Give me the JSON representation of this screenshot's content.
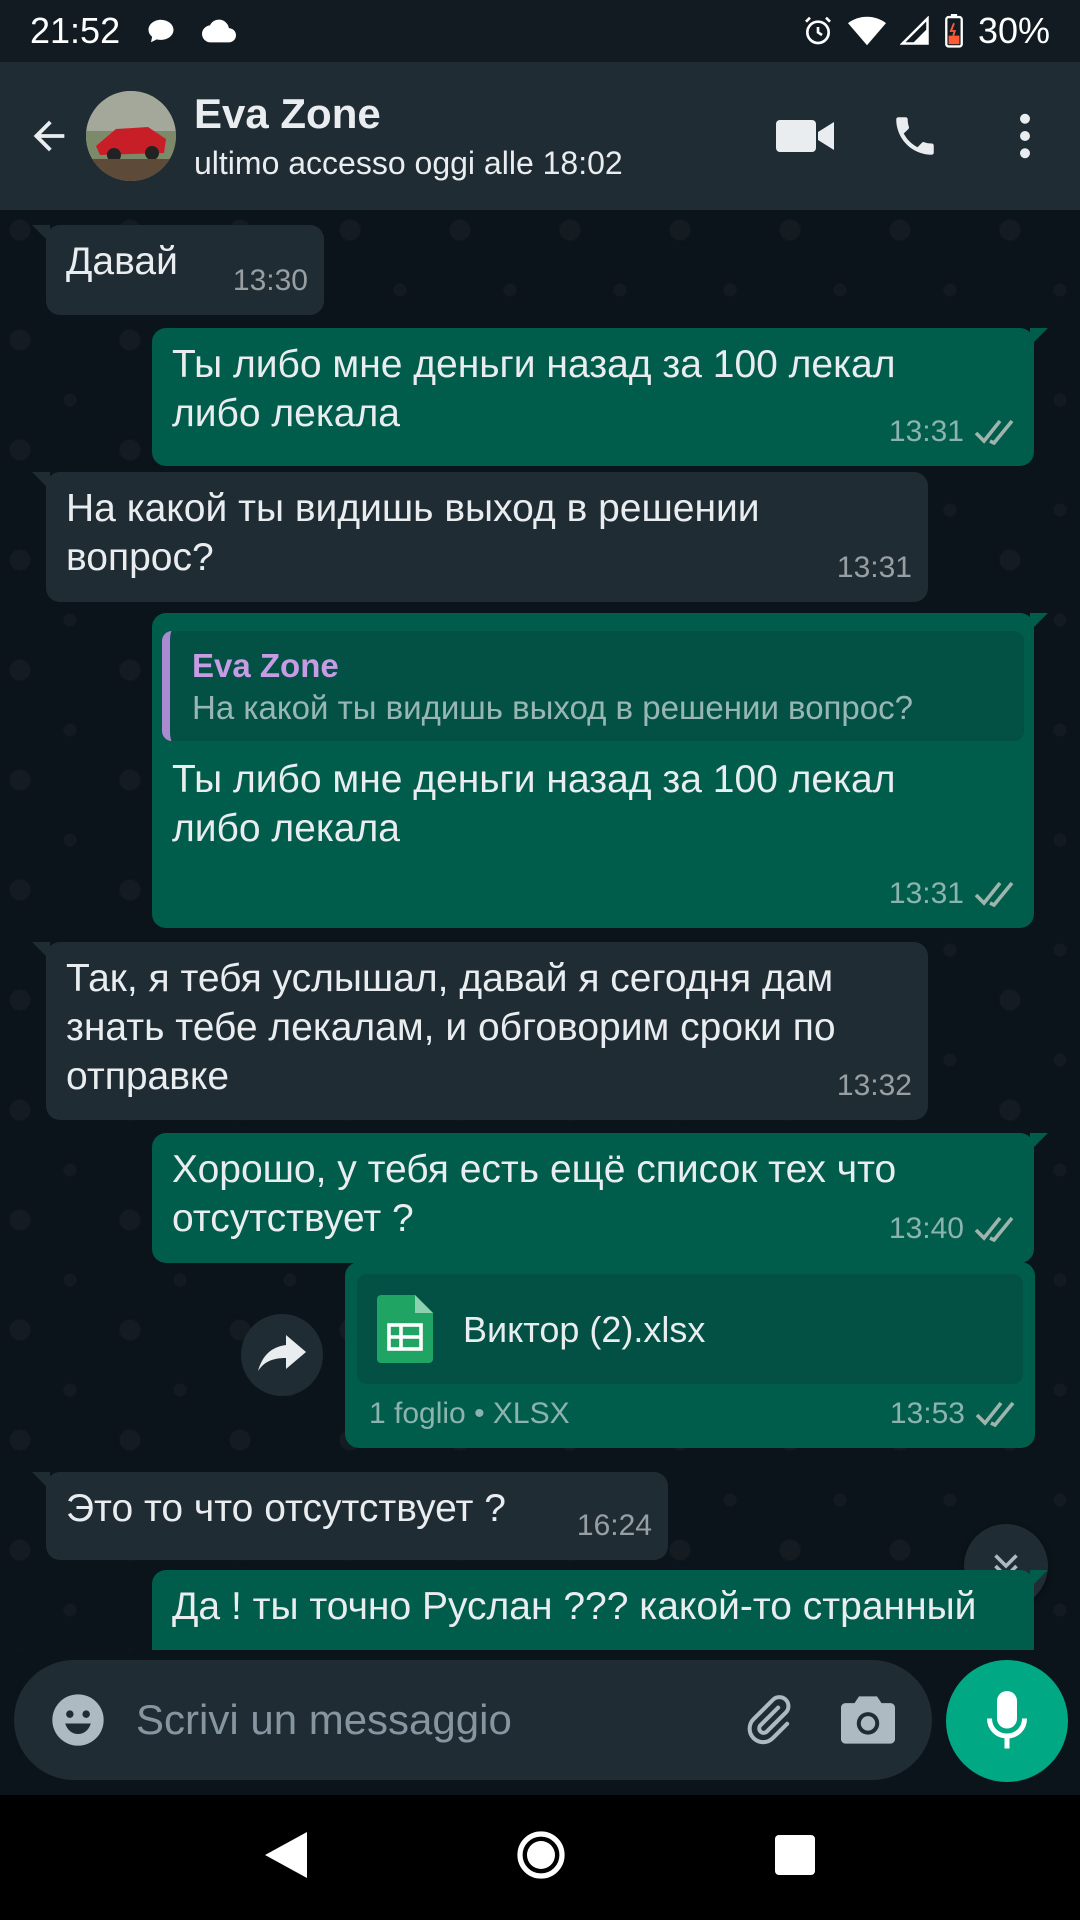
{
  "status_bar": {
    "time": "21:52",
    "battery": "30%",
    "icons": [
      "chat-bubble-icon",
      "cloud-icon",
      "alarm-icon",
      "wifi-icon",
      "signal-icon",
      "battery-icon"
    ]
  },
  "header": {
    "contact_name": "Eva Zone",
    "last_seen": "ultimo accesso oggi alle 18:02"
  },
  "messages": [
    {
      "dir": "in",
      "text": "Давай",
      "time": "13:30"
    },
    {
      "dir": "out",
      "text": "Ты либо мне деньги назад за 100 лекал либо лекала",
      "time": "13:31"
    },
    {
      "dir": "in",
      "text": "На какой ты видишь выход в решении вопрос?",
      "time": "13:31"
    },
    {
      "dir": "out",
      "quote_name": "Eva Zone",
      "quote_text": "На какой ты видишь выход в решении вопрос?",
      "text": "Ты либо мне деньги назад за 100 лекал либо лекала",
      "time": "13:31"
    },
    {
      "dir": "in",
      "text": "Так, я тебя услышал, давай я сегодня дам знать тебе лекалам, и обговорим сроки по отправке",
      "time": "13:32"
    },
    {
      "dir": "out",
      "text": "Хорошо, у тебя есть ещё список тех что отсутствует ?",
      "time": "13:40"
    },
    {
      "dir": "out",
      "file_name": "Виктор (2).xlsx",
      "file_info": "1 foglio • XLSX",
      "time": "13:53"
    },
    {
      "dir": "in",
      "text": "Это то что отсутствует ?",
      "time": "16:24"
    },
    {
      "dir": "out",
      "text": "Да ! ты точно Руслан ??? какой-то странный"
    }
  ],
  "composer": {
    "placeholder": "Scrivi un messaggio"
  },
  "colors": {
    "incoming_bubble": "#202c33",
    "outgoing_bubble": "#005c4b",
    "accent": "#00a884",
    "quote_name": "#c79ce4"
  }
}
